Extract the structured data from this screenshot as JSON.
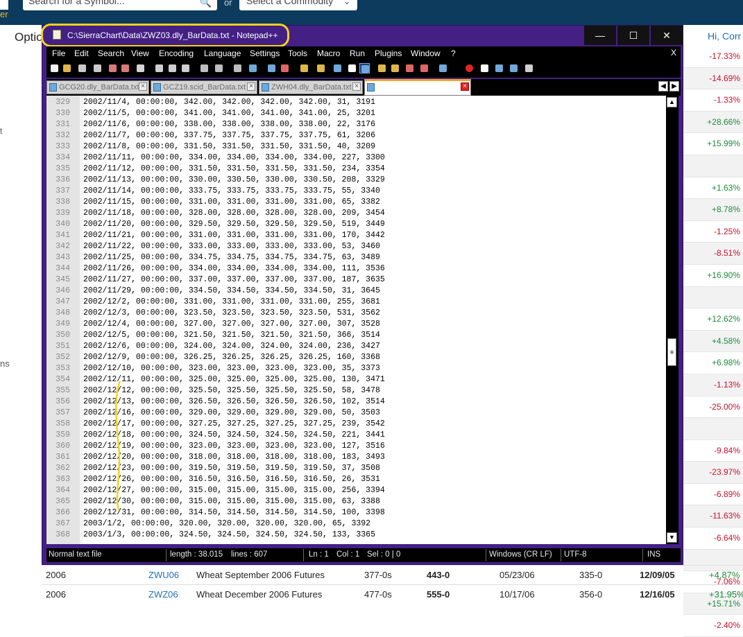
{
  "webpage": {
    "logo_text": "er",
    "search_placeholder": "Search for a Symbol...",
    "or_text": "or",
    "commodity_select": "Select a Commodity",
    "options_label": "Optio",
    "hi_label": "Hi, Corr",
    "side_t": "t",
    "side_ns": "ns",
    "percent_changes": [
      {
        "v": "-17.33%",
        "c": "neg"
      },
      {
        "v": "-14.69%",
        "c": "neg"
      },
      {
        "v": "-1.33%",
        "c": "neg"
      },
      {
        "v": "+28.66%",
        "c": "pos"
      },
      {
        "v": "+15.99%",
        "c": "pos"
      },
      {
        "v": "",
        "c": "pos"
      },
      {
        "v": "+1.63%",
        "c": "pos"
      },
      {
        "v": "+8.78%",
        "c": "pos"
      },
      {
        "v": "-1.25%",
        "c": "neg"
      },
      {
        "v": "-8.51%",
        "c": "neg"
      },
      {
        "v": "+16.90%",
        "c": "pos"
      },
      {
        "v": "",
        "c": "pos"
      },
      {
        "v": "+12.62%",
        "c": "pos"
      },
      {
        "v": "+4.58%",
        "c": "pos"
      },
      {
        "v": "+6.98%",
        "c": "pos"
      },
      {
        "v": "-1.13%",
        "c": "neg"
      },
      {
        "v": "-25.00%",
        "c": "neg"
      },
      {
        "v": "",
        "c": "pos"
      },
      {
        "v": "-9.84%",
        "c": "neg"
      },
      {
        "v": "-23.97%",
        "c": "neg"
      },
      {
        "v": "-6.89%",
        "c": "neg"
      },
      {
        "v": "-11.63%",
        "c": "neg"
      },
      {
        "v": "-6.64%",
        "c": "neg"
      },
      {
        "v": "",
        "c": "pos"
      },
      {
        "v": "-7.06%",
        "c": "neg"
      },
      {
        "v": "+15.71%",
        "c": "pos"
      },
      {
        "v": "-2.40%",
        "c": "neg"
      }
    ],
    "bottom_rows": [
      {
        "year": "2006",
        "symbol": "ZWU06",
        "name": "Wheat September 2006 Futures",
        "open": "377-0s",
        "high": "443-0",
        "high_date": "05/23/06",
        "low": "335-0",
        "low_date": "12/09/05",
        "change": "+4.87%",
        "c": "pos"
      },
      {
        "year": "2006",
        "symbol": "ZWZ06",
        "name": "Wheat December 2006 Futures",
        "open": "477-0s",
        "high": "555-0",
        "high_date": "10/17/06",
        "low": "356-0",
        "low_date": "12/16/05",
        "change": "+31.95%",
        "c": "pos"
      }
    ]
  },
  "window": {
    "title": "C:\\SierraChart\\Data\\ZWZ03.dly_BarData.txt - Notepad++",
    "minimize": "—",
    "maximize": "☐",
    "close": "✕"
  },
  "menu": [
    "File",
    "Edit",
    "Search",
    "View",
    "Encoding",
    "Language",
    "Settings",
    "Tools",
    "Macro",
    "Run",
    "Plugins",
    "Window",
    "?"
  ],
  "menu_close": "X",
  "tabs": [
    {
      "label": "GCG20.dly_BarData.txt"
    },
    {
      "label": "GCZ19.scid_BarData.txt"
    },
    {
      "label": "ZWH04.dly_BarData.txt"
    },
    {
      "label": ""
    }
  ],
  "editor": {
    "first_line": 329,
    "lines": [
      "2002/11/4, 00:00:00, 342.00, 342.00, 342.00, 342.00, 31, 3191",
      "2002/11/5, 00:00:00, 341.00, 341.00, 341.00, 341.00, 25, 3201",
      "2002/11/6, 00:00:00, 338.00, 338.00, 338.00, 338.00, 22, 3176",
      "2002/11/7, 00:00:00, 337.75, 337.75, 337.75, 337.75, 61, 3206",
      "2002/11/8, 00:00:00, 331.50, 331.50, 331.50, 331.50, 40, 3209",
      "2002/11/11, 00:00:00, 334.00, 334.00, 334.00, 334.00, 227, 3300",
      "2002/11/12, 00:00:00, 331.50, 331.50, 331.50, 331.50, 234, 3354",
      "2002/11/13, 00:00:00, 330.00, 330.50, 330.00, 330.50, 208, 3329",
      "2002/11/14, 00:00:00, 333.75, 333.75, 333.75, 333.75, 55, 3340",
      "2002/11/15, 00:00:00, 331.00, 331.00, 331.00, 331.00, 65, 3382",
      "2002/11/18, 00:00:00, 328.00, 328.00, 328.00, 328.00, 209, 3454",
      "2002/11/20, 00:00:00, 329.50, 329.50, 329.50, 329.50, 519, 3449",
      "2002/11/21, 00:00:00, 331.00, 331.00, 331.00, 331.00, 170, 3442",
      "2002/11/22, 00:00:00, 333.00, 333.00, 333.00, 333.00, 53, 3460",
      "2002/11/25, 00:00:00, 334.75, 334.75, 334.75, 334.75, 63, 3489",
      "2002/11/26, 00:00:00, 334.00, 334.00, 334.00, 334.00, 111, 3536",
      "2002/11/27, 00:00:00, 337.00, 337.00, 337.00, 337.00, 187, 3635",
      "2002/11/29, 00:00:00, 334.50, 334.50, 334.50, 334.50, 31, 3645",
      "2002/12/2, 00:00:00, 331.00, 331.00, 331.00, 331.00, 255, 3681",
      "2002/12/3, 00:00:00, 323.50, 323.50, 323.50, 323.50, 531, 3562",
      "2002/12/4, 00:00:00, 327.00, 327.00, 327.00, 327.00, 307, 3528",
      "2002/12/5, 00:00:00, 321.50, 321.50, 321.50, 321.50, 366, 3514",
      "2002/12/6, 00:00:00, 324.00, 324.00, 324.00, 324.00, 236, 3427",
      "2002/12/9, 00:00:00, 326.25, 326.25, 326.25, 326.25, 160, 3368",
      "2002/12/10, 00:00:00, 323.00, 323.00, 323.00, 323.00, 35, 3373",
      "2002/12/11, 00:00:00, 325.00, 325.00, 325.00, 325.00, 130, 3471",
      "2002/12/12, 00:00:00, 325.50, 325.50, 325.50, 325.50, 58, 3478",
      "2002/12/13, 00:00:00, 326.50, 326.50, 326.50, 326.50, 102, 3514",
      "2002/12/16, 00:00:00, 329.00, 329.00, 329.00, 329.00, 50, 3503",
      "2002/12/17, 00:00:00, 327.25, 327.25, 327.25, 327.25, 239, 3542",
      "2002/12/18, 00:00:00, 324.50, 324.50, 324.50, 324.50, 221, 3441",
      "2002/12/19, 00:00:00, 323.00, 323.00, 323.00, 323.00, 127, 3516",
      "2002/12/20, 00:00:00, 318.00, 318.00, 318.00, 318.00, 183, 3493",
      "2002/12/23, 00:00:00, 319.50, 319.50, 319.50, 319.50, 37, 3508",
      "2002/12/26, 00:00:00, 316.50, 316.50, 316.50, 316.50, 26, 3531",
      "2002/12/27, 00:00:00, 315.00, 315.00, 315.00, 315.00, 256, 3394",
      "2002/12/30, 00:00:00, 315.00, 315.00, 315.00, 315.00, 63, 3388",
      "2002/12/31, 00:00:00, 314.50, 314.50, 314.50, 314.50, 100, 3398",
      "2003/1/2, 00:00:00, 320.00, 320.00, 320.00, 320.00, 65, 3392",
      "2003/1/3, 00:00:00, 324.50, 324.50, 324.50, 324.50, 133, 3365"
    ]
  },
  "status": {
    "file_type": "Normal text file",
    "length": "length : 38.015",
    "lines": "lines : 607",
    "ln": "Ln : 1",
    "col": "Col : 1",
    "sel": "Sel : 0 | 0",
    "eol": "Windows (CR LF)",
    "encoding": "UTF-8",
    "mode": "INS"
  },
  "colors": {
    "window_frame": "#441f84",
    "highlight": "#f4d21f",
    "page_header": "#0c3b5e"
  }
}
